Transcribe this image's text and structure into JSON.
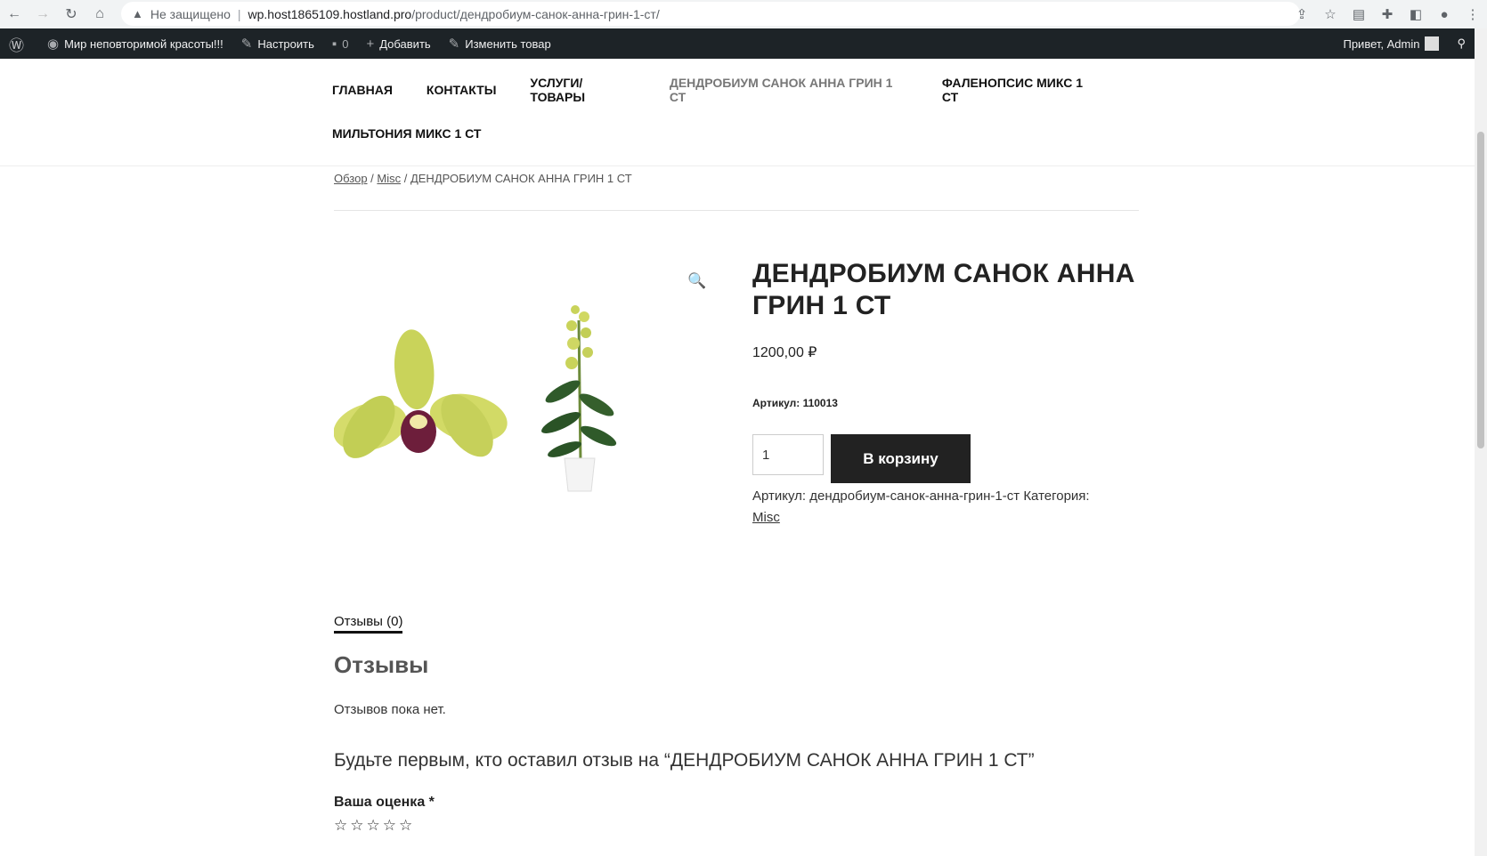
{
  "browser": {
    "security_label": "Не защищено",
    "url_host": "wp.host1865109.hostland.pro",
    "url_path": "/product/дендробиум-санок-анна-грин-1-ст/"
  },
  "admin_bar": {
    "site_name": "Мир неповторимой красоты!!!",
    "customize": "Настроить",
    "comments_count": "0",
    "add_new": "Добавить",
    "edit_product": "Изменить товар",
    "greeting": "Привет, Admin"
  },
  "nav": {
    "items": [
      {
        "label": "ГЛАВНАЯ"
      },
      {
        "label": "КОНТАКТЫ"
      },
      {
        "label": "УСЛУГИ/ТОВАРЫ"
      },
      {
        "label": "ДЕНДРОБИУМ САНОК АННА ГРИН 1 СТ"
      },
      {
        "label": "ФАЛЕНОПСИС МИКС 1 СТ"
      },
      {
        "label": "МИЛЬТОНИЯ МИКС 1 СТ"
      }
    ]
  },
  "breadcrumb": {
    "home": "Обзор",
    "sep": " / ",
    "category": "Misc",
    "current": "ДЕНДРОБИУМ САНОК АННА ГРИН 1 СТ"
  },
  "product": {
    "title": "ДЕНДРОБИУМ САНОК АННА ГРИН 1 СТ",
    "price": "1200,00 ₽",
    "sku_line": "Артикул: 110013",
    "qty": "1",
    "add_to_cart": "В корзину",
    "meta_sku": "Артикул: дендробиум-санок-анна-грин-1-ст",
    "meta_category_label": "Категория:",
    "meta_category": "Misc"
  },
  "reviews": {
    "tab_label": "Отзывы (0)",
    "heading": "Отзывы",
    "no_reviews": "Отзывов пока нет.",
    "be_first": "Будьте первым, кто оставил отзыв на “ДЕНДРОБИУМ САНОК АННА ГРИН 1 СТ”",
    "rating_label": "Ваша оценка",
    "required_mark": "*"
  },
  "icons": {
    "zoom": "magnifier-icon",
    "star": "☆"
  }
}
